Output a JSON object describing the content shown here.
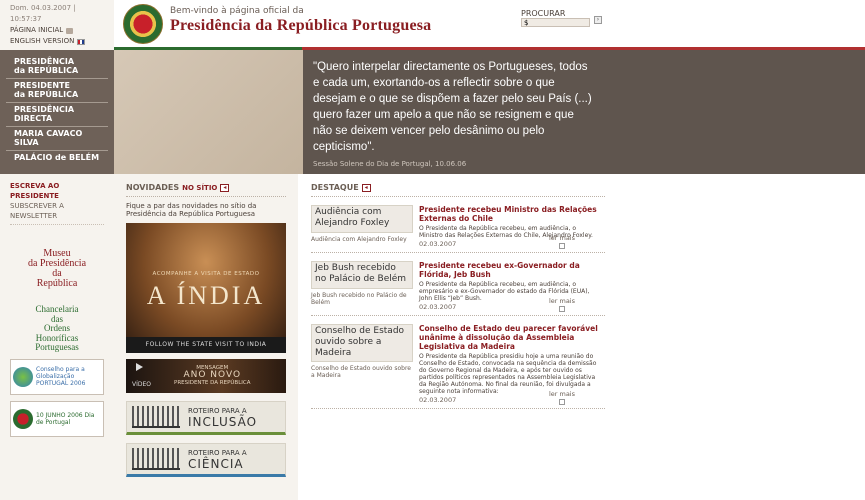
{
  "util": {
    "date": "Dom. 04.03.2007 | 10:57:37",
    "home": "PÁGINA INICIAL",
    "english": "ENGLISH VERSION"
  },
  "header": {
    "welcome": "Bem-vindo à página oficial da",
    "title": "Presidência da República Portuguesa",
    "search_label": "PROCURAR",
    "search_value": "$"
  },
  "nav": {
    "items": [
      {
        "l1": "PRESIDÊNCIA",
        "l2": "da REPÚBLICA"
      },
      {
        "l1": "PRESIDENTE",
        "l2": "da REPÚBLICA"
      },
      {
        "l1": "PRESIDÊNCIA",
        "l2": "DIRECTA"
      },
      {
        "l1": "MARIA CAVACO SILVA",
        "l2": ""
      },
      {
        "l1": "PALÁCIO de BELÉM",
        "l2": ""
      }
    ]
  },
  "quote": {
    "text": "\"Quero interpelar directamente os Portugueses, todos e cada um, exortando-os a reflectir sobre o que desejam e o que se dispõem a fazer pelo seu País (...) quero fazer um apelo a que não se resignem e que não se deixem vencer pelo desânimo ou pelo cepticismo\".",
    "source": "Sessão Solene do Dia de Portugal, 10.06.06"
  },
  "left": {
    "escreva": "ESCREVA AO PRESIDENTE",
    "newsletter": "SUBSCREVER A NEWSLETTER",
    "museu": [
      "Museu",
      "da Presidência",
      "da",
      "República"
    ],
    "chancelaria": [
      "Chancelaria",
      "das",
      "Ordens",
      "Honoríficas",
      "Portuguesas"
    ],
    "badge1": "Conselho para a Globalização PORTUGAL 2006",
    "badge2": "10 JUNHO 2006 Dia de Portugal"
  },
  "novidades": {
    "h_main": "NOVIDADES",
    "h_sub": "NO SÍTIO",
    "intro": "Fique a par das novidades no sítio da Presidência da República Portuguesa",
    "india_pre": "ACOMPANHE A VISITA DE ESTADO",
    "india_big": "A ÍNDIA",
    "india_foot": "FOLLOW THE STATE VISIT TO INDIA",
    "video": "VÍDEO",
    "ano_l1": "MENSAGEM",
    "ano_l2": "ANO NOVO",
    "ano_l3": "PRESIDENTE DA REPÚBLICA",
    "roteiro1_a": "ROTEIRO PARA A",
    "roteiro1_b": "INCLUSÃO",
    "roteiro2_a": "ROTEIRO PARA A",
    "roteiro2_b": "CIÊNCIA"
  },
  "destaque": {
    "h": "DESTAQUE",
    "more": "ler mais",
    "items": [
      {
        "img": "Audiência com Alejandro Foxley",
        "cap": "Audiência com Alejandro Foxley",
        "title": "Presidente recebeu Ministro das Relações Externas do Chile",
        "text": "O Presidente da República recebeu, em audiência, o Ministro das Relações Externas do Chile, Alejandro Foxley.",
        "date": "02.03.2007"
      },
      {
        "img": "Jeb Bush recebido no Palácio de Belém",
        "cap": "Jeb Bush recebido no Palácio de Belém",
        "title": "Presidente recebeu ex-Governador da Flórida, Jeb Bush",
        "text": "O Presidente da República recebeu, em audiência, o empresário e ex-Governador do estado da Flórida (EUA), John Ellis “Jeb” Bush.",
        "date": "02.03.2007"
      },
      {
        "img": "Conselho de Estado ouvido sobre a Madeira",
        "cap": "Conselho de Estado ouvido sobre a Madeira",
        "title": "Conselho de Estado deu parecer favorável unânime à dissolução da Assembleia Legislativa da Madeira",
        "text": "O Presidente da República presidiu hoje a uma reunião do Conselho de Estado, convocada na sequência da demissão do Governo Regional da Madeira, e após ter ouvido os partidos políticos representados na Assembleia Legislativa da Região Autónoma. No final da reunião, foi divulgada a seguinte nota informativa:",
        "date": "02.03.2007"
      }
    ]
  }
}
